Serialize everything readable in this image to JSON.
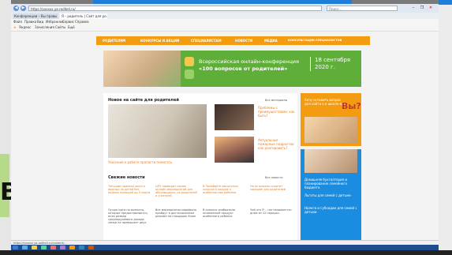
{
  "browser": {
    "address": "https://xxxxxx.ya-roditeli.ru/",
    "search_placeholder": "Поиск...",
    "tabs": [
      "Конференции – Вы правы ...",
      "Я – родитель | Сайт для ро..."
    ],
    "menu": [
      "Файл",
      "Правка",
      "Вид",
      "Избранное",
      "Сервис",
      "Справка"
    ],
    "favorites": [
      "Яндекс",
      "Зачисления",
      "Сайты",
      "Ещё"
    ],
    "window_buttons": [
      "–",
      "❐",
      "✕"
    ]
  },
  "site": {
    "nav": [
      "РОДИТЕЛЯМ",
      "КОНКУРСЫ И АКЦИИ",
      "СПЕЦИАЛИСТАМ",
      "НОВОСТИ",
      "МЕДИА",
      "КОНСУЛЬТАЦИИ СПЕЦИАЛИСТОВ"
    ],
    "banner": {
      "line1": "Всероссийская онлайн-конференция",
      "line2": "«100 вопросов от родителей»",
      "date1": "18 сентября",
      "date2": "2020 г."
    },
    "new_section": {
      "title": "Новое на сайте для родителей",
      "all_link": "Все материалы",
      "main_caption": "Указания к работе пропасти помогать",
      "items": [
        {
          "title": "Проблемы с преимуществами: как быть?"
        },
        {
          "title": "Актуальные пожарные подросток: как реагировать?"
        }
      ]
    },
    "fresh_news": {
      "title": "Свежие новости",
      "all_link": "Все новости",
      "items": [
        {
          "title": "Текущие приказы школ о важных на детей без родных помощей до 5 марта",
          "text": "Лучше идти на выплаты, которые предоставляются, если размер среднедушевого дохода семьи не превышает двух"
        },
        {
          "title": "ЦПУ проводит серию онлайн-мероприятий для обучающихся, их родителей и учителей",
          "text": "Все мероприятия марафона пройдут в дистанционном режиме на площадке Zoom"
        },
        {
          "title": "В Приобрете выпускных классов в каждое к особенностям ребенка",
          "text": "В конкисе изобразили экзаменный продукт особенного ребенка"
        },
        {
          "title": "На Астрахань спортит хорошее для родителей",
          "text": "Чей это Я – «не называется» днем из 12 передач"
        }
      ]
    },
    "side_promo": {
      "line1": "Хочу оставить вопрос для сайта о в школе как",
      "question": "Вы?"
    },
    "side_blue_items": [
      "Домашняя бухгалтерия и планирование семейного бюджета",
      "Льготы для семей с детьми",
      "Налоги и субсидии для семей с детьми"
    ]
  },
  "status_bar": "https://xxxxxx.ya-roditeli.ru/content/...",
  "slide_letter": "B"
}
